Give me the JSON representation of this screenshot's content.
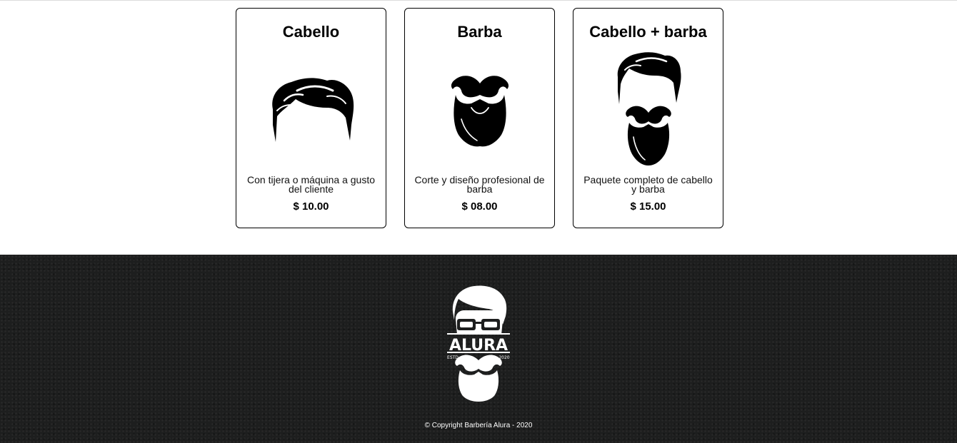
{
  "products": [
    {
      "title": "Cabello",
      "description": "Con tijera o máquina a gusto del cliente",
      "price": "$ 10.00",
      "icon": "hair-icon"
    },
    {
      "title": "Barba",
      "description": "Corte y diseño profesional de barba",
      "price": "$ 08.00",
      "icon": "beard-icon"
    },
    {
      "title": "Cabello + barba",
      "description": "Paquete completo de cabello y barba",
      "price": "$ 15.00",
      "icon": "hair-and-beard-icon"
    }
  ],
  "footer": {
    "logo": {
      "brand": "ALURA",
      "estd_label": "ESTD",
      "year": "2020",
      "icon": "barber-logo-icon"
    },
    "copyright": "© Copyright Barbería Alura - 2020"
  },
  "colors": {
    "footer_background": "#1d1e1e",
    "card_border": "#000000",
    "text": "#000000"
  }
}
